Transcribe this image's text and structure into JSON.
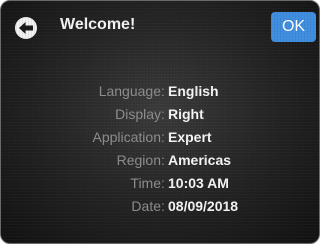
{
  "header": {
    "back_icon": "arrow-left-circle-icon",
    "title": "Welcome!",
    "ok_label": "OK",
    "ok_color": "#3f8de0"
  },
  "info": [
    {
      "label": "Language",
      "value": "English"
    },
    {
      "label": "Display",
      "value": "Right"
    },
    {
      "label": "Application",
      "value": "Expert"
    },
    {
      "label": "Region",
      "value": "Americas"
    },
    {
      "label": "Time",
      "value": "10:03 AM"
    },
    {
      "label": "Date",
      "value": "08/09/2018"
    }
  ],
  "separator": ":"
}
